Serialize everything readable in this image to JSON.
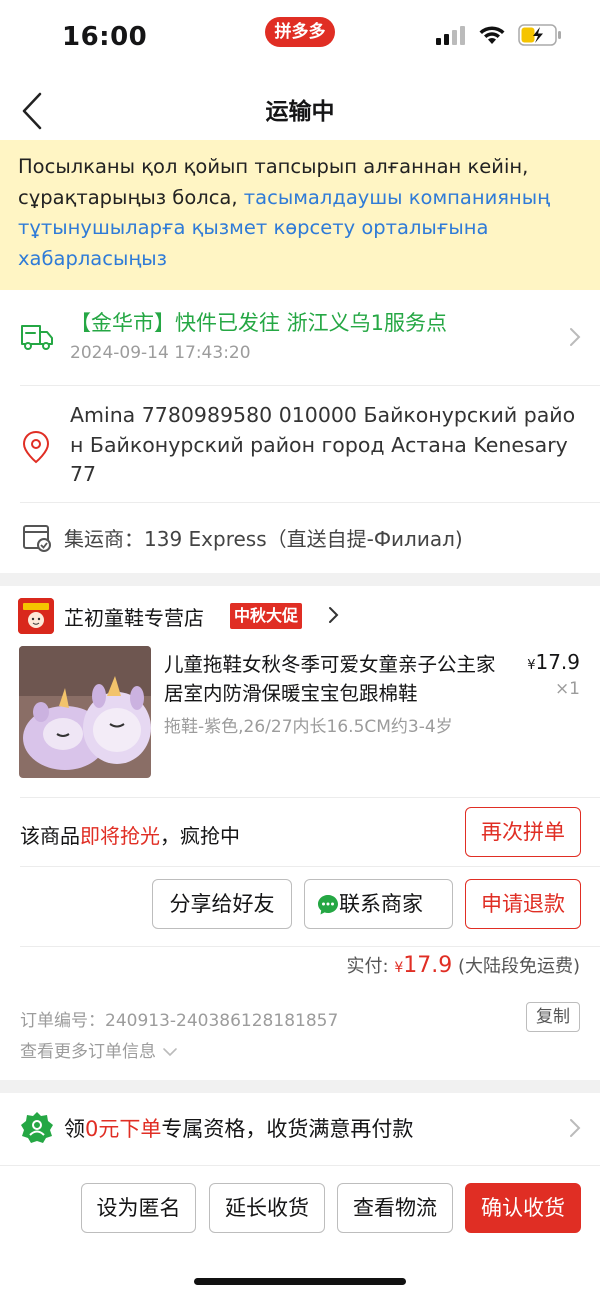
{
  "status_bar": {
    "time": "16:00",
    "badge": "拼多多"
  },
  "nav": {
    "title": "运输中"
  },
  "notice": {
    "text_plain": "Посылканы қол қойып тапсырып алғаннан кейін, сұрақтарыңыз болса, ",
    "text_link": "тасымалдаушы компанияның тұтынушыларға қызмет көрсету орталығына хабарласыңыз"
  },
  "logistics": {
    "status": "【金华市】快件已发往 浙江义乌1服务点",
    "time": "2024-09-14 17:43:20"
  },
  "address": {
    "text": "Amina 7780989580 010000 Байконурский район Байконурский район город Астана Kenesary 77"
  },
  "shipper": {
    "text": "集运商：139 Express（直送自提-Филиал)"
  },
  "store": {
    "name": "芷初童鞋专营店",
    "promo_badge": "中秋大促"
  },
  "product": {
    "title": "儿童拖鞋女秋冬季可爱女童亲子公主家居室内防滑保暖宝宝包跟棉鞋",
    "spec": "拖鞋-紫色,26/27内长16.5CM约3-4岁",
    "currency": "¥",
    "price": "17.9",
    "qty": "×1"
  },
  "hot": {
    "prefix": "该商品",
    "highlight": "即将抢光",
    "suffix": "，疯抢中",
    "button": "再次拼单"
  },
  "actions": {
    "share": "分享给好友",
    "contact": "联系商家",
    "refund": "申请退款"
  },
  "payment": {
    "label": "实付: ",
    "currency": "¥",
    "amount": "17.9",
    "note": " (大陆段免运费)"
  },
  "order": {
    "number": "订单编号：240913-240386128181857",
    "copy": "复制",
    "more": "查看更多订单信息"
  },
  "coupon": {
    "prefix": "领",
    "highlight": "0元下单",
    "suffix": "专属资格，收货满意再付款"
  },
  "bottom": {
    "anonymous": "设为匿名",
    "extend": "延长收货",
    "track": "查看物流",
    "confirm": "确认收货"
  },
  "colors": {
    "brand_red": "#e02e24",
    "notice_bg": "#fff5c4",
    "link_blue": "#2f7bd7",
    "logistics_green": "#25a744"
  }
}
